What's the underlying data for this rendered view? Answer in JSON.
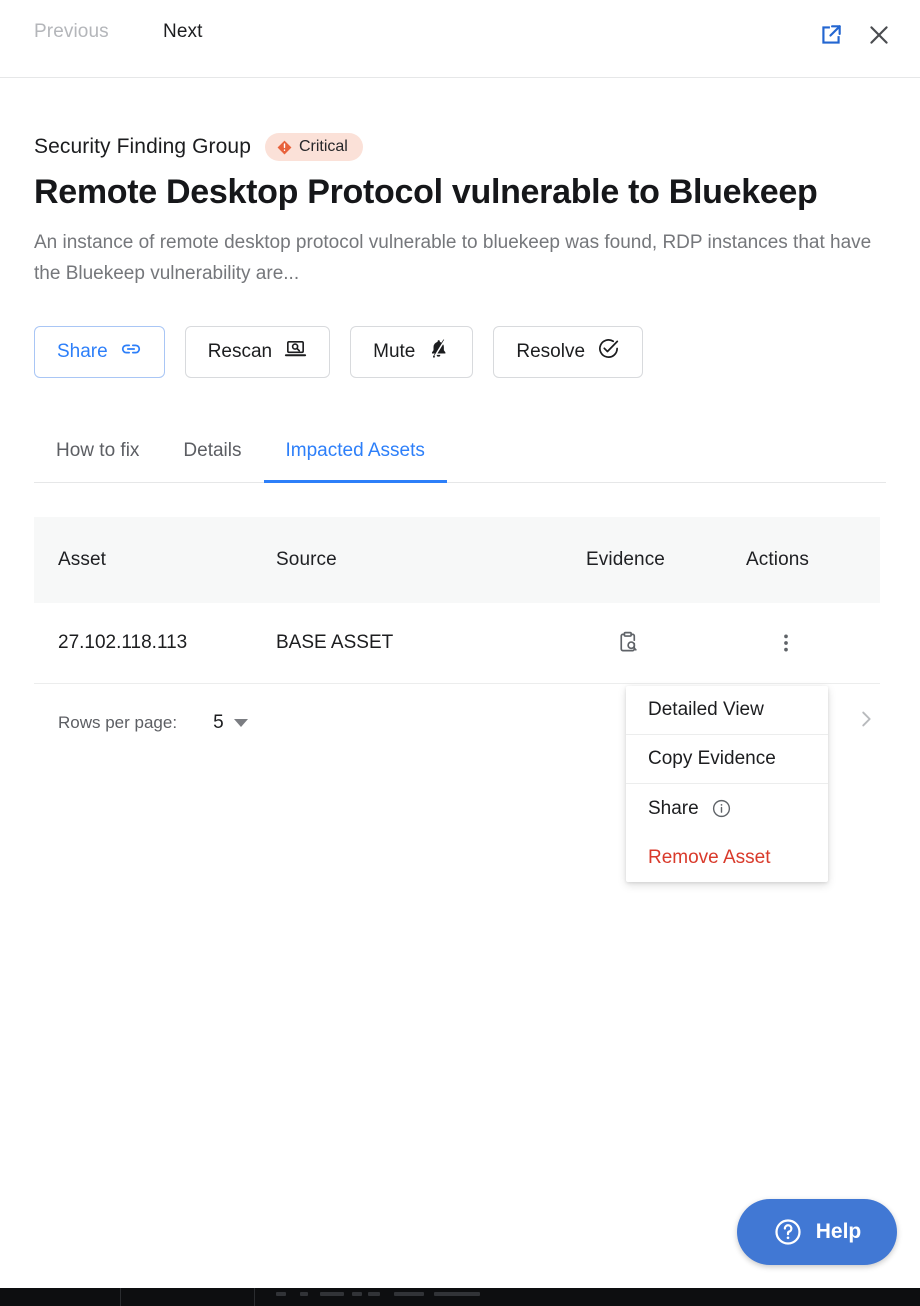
{
  "topbar": {
    "previous_label": "Previous",
    "next_label": "Next",
    "open_external_icon": "external-link-icon",
    "close_icon": "close-icon"
  },
  "finding": {
    "kicker": "Security Finding Group",
    "severity_label": "Critical",
    "severity_color": "#e8623c",
    "severity_bg": "#fbe1d8",
    "title": "Remote Desktop Protocol vulnerable to Bluekeep",
    "description": "An instance of remote desktop protocol vulnerable to bluekeep was found, RDP instances that have the Bluekeep vulnerability are..."
  },
  "actions": [
    {
      "label": "Share",
      "icon": "link-icon",
      "primary": true
    },
    {
      "label": "Rescan",
      "icon": "laptop-scan-icon",
      "primary": false
    },
    {
      "label": "Mute",
      "icon": "bell-off-icon",
      "primary": false
    },
    {
      "label": "Resolve",
      "icon": "check-circle-icon",
      "primary": false
    }
  ],
  "tabs": [
    {
      "label": "How to fix",
      "active": false
    },
    {
      "label": "Details",
      "active": false
    },
    {
      "label": "Impacted Assets",
      "active": true
    }
  ],
  "table": {
    "columns": [
      "Asset",
      "Source",
      "Evidence",
      "Actions"
    ],
    "rows": [
      {
        "asset": "27.102.118.113",
        "source": "BASE ASSET",
        "evidence_icon": "clipboard-search-icon",
        "actions_icon": "kebab-menu-icon"
      }
    ]
  },
  "pagination": {
    "rows_per_page_label": "Rows per page:",
    "rows_per_page_value": "5",
    "next_page_icon": "chevron-right-icon"
  },
  "row_menu": {
    "items": [
      {
        "label": "Detailed View",
        "icon": null,
        "danger": false,
        "divider": true
      },
      {
        "label": "Copy Evidence",
        "icon": null,
        "danger": false,
        "divider": true
      },
      {
        "label": "Share",
        "icon": "info-icon",
        "danger": false,
        "divider": false
      },
      {
        "label": "Remove Asset",
        "icon": null,
        "danger": true,
        "divider": false
      }
    ]
  },
  "help": {
    "label": "Help",
    "icon": "question-circle-icon",
    "color": "#4178d4"
  },
  "theme": {
    "accent_blue": "#2d7ff9",
    "danger_red": "#d93a2b",
    "header_bg": "#f7f8f8"
  }
}
